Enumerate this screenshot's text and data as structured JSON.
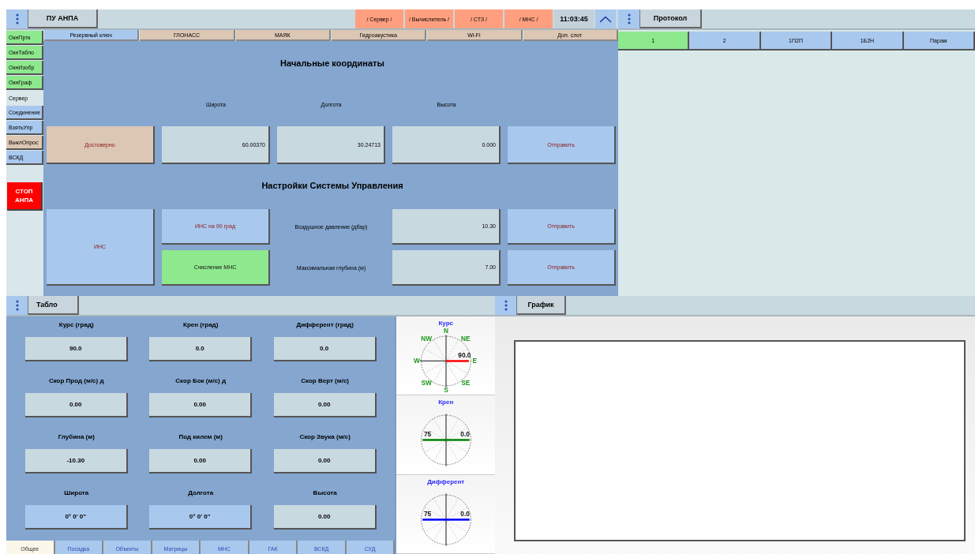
{
  "control_panel": {
    "title": "ПУ АНПА",
    "status_indicators": [
      {
        "label": "/ Сервер /"
      },
      {
        "label": "/ Вычислитель /"
      },
      {
        "label": "/ СТЗ /"
      },
      {
        "label": "/ МНС /"
      }
    ],
    "time": "11:03:45",
    "sidebar": [
      {
        "label": "ОкнПртк",
        "kind": "toggle",
        "on": true
      },
      {
        "label": "ОкнТабло",
        "kind": "toggle",
        "on": true
      },
      {
        "label": "ОкнИзобр",
        "kind": "toggle",
        "on": true
      },
      {
        "label": "ОкнГраф",
        "kind": "toggle",
        "on": true
      },
      {
        "label": "Сервер",
        "kind": "caption"
      },
      {
        "label": "Соединение",
        "kind": "button",
        "pressed": false
      },
      {
        "label": "ВзятьУпр",
        "kind": "button",
        "pressed": false
      },
      {
        "label": "ВыклОпрос",
        "kind": "button",
        "pressed": true
      },
      {
        "label": "ВСКД",
        "kind": "button",
        "pressed": false
      }
    ],
    "stop_button": "СТОП АНПА",
    "tabs": [
      {
        "label": "Резервный ключ",
        "selected": true
      },
      {
        "label": "ГЛОНАСС",
        "selected": false
      },
      {
        "label": "МАЯК",
        "selected": false
      },
      {
        "label": "Гидроакустика",
        "selected": false
      },
      {
        "label": "Wi-Fi",
        "selected": false
      },
      {
        "label": "Доп. слот",
        "selected": false
      }
    ],
    "coordinates": {
      "title": "Начальные координаты",
      "status_button": "Достоверно",
      "fields": [
        {
          "label": "Широта",
          "value": "60.00370"
        },
        {
          "label": "Долгота",
          "value": "30.24713"
        },
        {
          "label": "Высота",
          "value": "0.000"
        }
      ],
      "send_button": "Отправить"
    },
    "control_settings": {
      "title": "Настройки Системы Управления",
      "main_mode": "ИНС",
      "modes": [
        {
          "label": "ИНС на 90 град",
          "selected": false
        },
        {
          "label": "Счисление МНС",
          "selected": true
        }
      ],
      "params": [
        {
          "label": "Воздушное давление (дбар)",
          "value": "10.30",
          "send_button": "Отправить"
        },
        {
          "label": "Максимальная глубина (м)",
          "value": "7.00",
          "send_button": "Отправить"
        }
      ]
    }
  },
  "protocol": {
    "title": "Протокол",
    "tabs": [
      {
        "label": "1",
        "selected": true
      },
      {
        "label": "2",
        "selected": false
      },
      {
        "label": "1П2П",
        "selected": false
      },
      {
        "label": "1Б2Н",
        "selected": false
      },
      {
        "label": "Парам",
        "selected": false
      }
    ]
  },
  "tablo": {
    "title": "Табло",
    "readings": [
      {
        "label": "Курс (град)",
        "value": "90.0",
        "accent": false
      },
      {
        "label": "Крен (град)",
        "value": "0.0",
        "accent": false
      },
      {
        "label": "Дифферент (град)",
        "value": "0.0",
        "accent": false
      },
      {
        "label": "Скор Прод (м/с) д",
        "value": "0.00",
        "accent": false
      },
      {
        "label": "Скор Бок (м/с) д",
        "value": "0.00",
        "accent": false
      },
      {
        "label": "Скор Верт (м/с)",
        "value": "0.00",
        "accent": false
      },
      {
        "label": "Глубина (м)",
        "value": "-10.30",
        "accent": false
      },
      {
        "label": "Под килем (м)",
        "value": "0.00",
        "accent": false
      },
      {
        "label": "Скор Звука (м/с)",
        "value": "0.00",
        "accent": false
      },
      {
        "label": "Широта",
        "value": "0° 0' 0\"",
        "accent": true
      },
      {
        "label": "Долгота",
        "value": "0° 0' 0\"",
        "accent": true
      },
      {
        "label": "Высота",
        "value": "0.00",
        "accent": false
      }
    ],
    "tabs": [
      {
        "label": "Общее",
        "selected": true
      },
      {
        "label": "Посадка",
        "selected": false
      },
      {
        "label": "Объекты",
        "selected": false
      },
      {
        "label": "Матрицы",
        "selected": false
      },
      {
        "label": "МНС",
        "selected": false
      },
      {
        "label": "ГАК",
        "selected": false
      },
      {
        "label": "ВСКД",
        "selected": false
      },
      {
        "label": "СУД",
        "selected": false
      }
    ]
  },
  "gauges": [
    {
      "title": "Курс",
      "kind": "compass",
      "color": "#ff0000",
      "value": "90.0",
      "directions": [
        "N",
        "NE",
        "E",
        "SE",
        "S",
        "SW",
        "W",
        "NW"
      ]
    },
    {
      "title": "Крен",
      "kind": "attitude",
      "color": "#008000",
      "scale": "75",
      "value": "0.0"
    },
    {
      "title": "Дифферент",
      "kind": "attitude",
      "color": "#0000ff",
      "scale": "75",
      "value": "0.0"
    }
  ],
  "graph": {
    "title": "График"
  }
}
